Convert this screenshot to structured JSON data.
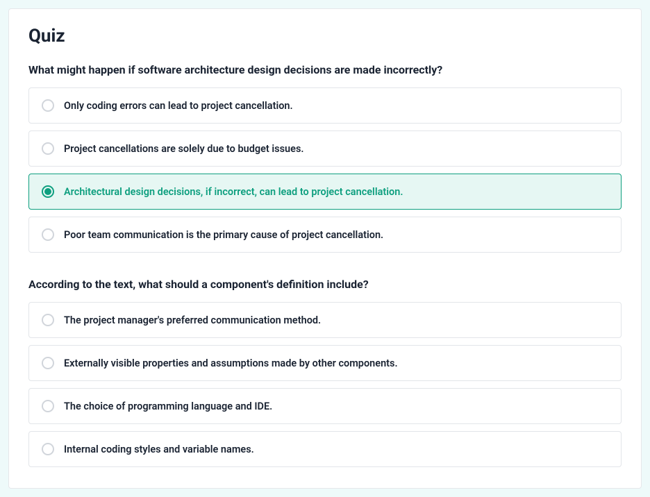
{
  "title": "Quiz",
  "questions": [
    {
      "prompt": "What might happen if software architecture design decisions are made incorrectly?",
      "options": [
        {
          "text": "Only coding errors can lead to project cancellation.",
          "selected": false
        },
        {
          "text": "Project cancellations are solely due to budget issues.",
          "selected": false
        },
        {
          "text": "Architectural design decisions, if incorrect, can lead to project cancellation.",
          "selected": true
        },
        {
          "text": "Poor team communication is the primary cause of project cancellation.",
          "selected": false
        }
      ]
    },
    {
      "prompt": "According to the text, what should a component's definition include?",
      "options": [
        {
          "text": "The project manager's preferred communication method.",
          "selected": false
        },
        {
          "text": "Externally visible properties and assumptions made by other components.",
          "selected": false
        },
        {
          "text": "The choice of programming language and IDE.",
          "selected": false
        },
        {
          "text": "Internal coding styles and variable names.",
          "selected": false
        }
      ]
    }
  ]
}
